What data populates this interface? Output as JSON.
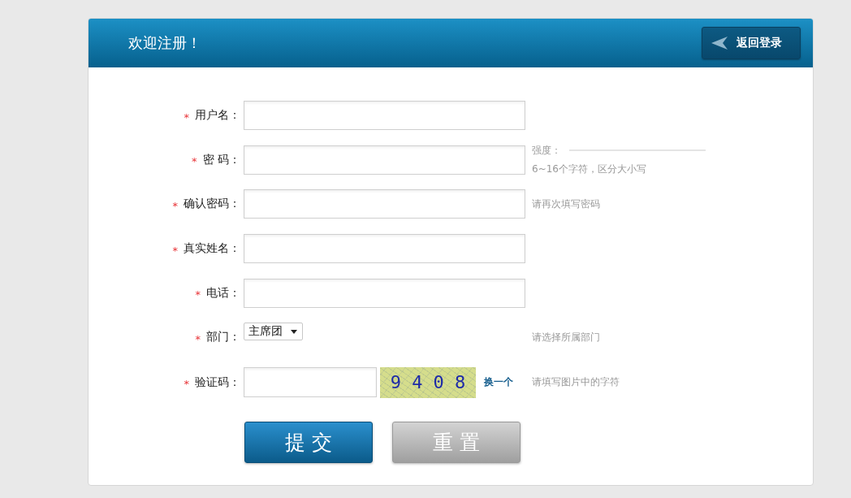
{
  "header": {
    "title": "欢迎注册！",
    "back_button": "返回登录"
  },
  "fields": [
    {
      "kind": "input",
      "mark": "*",
      "label": "用户名："
    },
    {
      "kind": "input",
      "mark": "*",
      "label": "密 码：",
      "strength": {
        "label": "强度：",
        "level": 0
      },
      "hint": "6~16个字符，区分大小写"
    },
    {
      "kind": "input",
      "mark": "*",
      "label": "确认密码：",
      "hint": "请再次填写密码"
    },
    {
      "kind": "input",
      "mark": "*",
      "label": "真实姓名："
    },
    {
      "kind": "input",
      "mark": "*",
      "label": "电话："
    },
    {
      "kind": "select",
      "mark": "*",
      "label": "部门：",
      "value": "主席团",
      "hint": "请选择所属部门"
    },
    {
      "kind": "captcha",
      "mark": "*",
      "label": "验证码：",
      "captcha_text": "9 4 0 8",
      "refresh_link": "换一个",
      "hint": "请填写图片中的字符"
    }
  ],
  "buttons": [
    {
      "kind": "primary",
      "label": "提 交"
    },
    {
      "kind": "secondary",
      "label": "重 置"
    }
  ]
}
